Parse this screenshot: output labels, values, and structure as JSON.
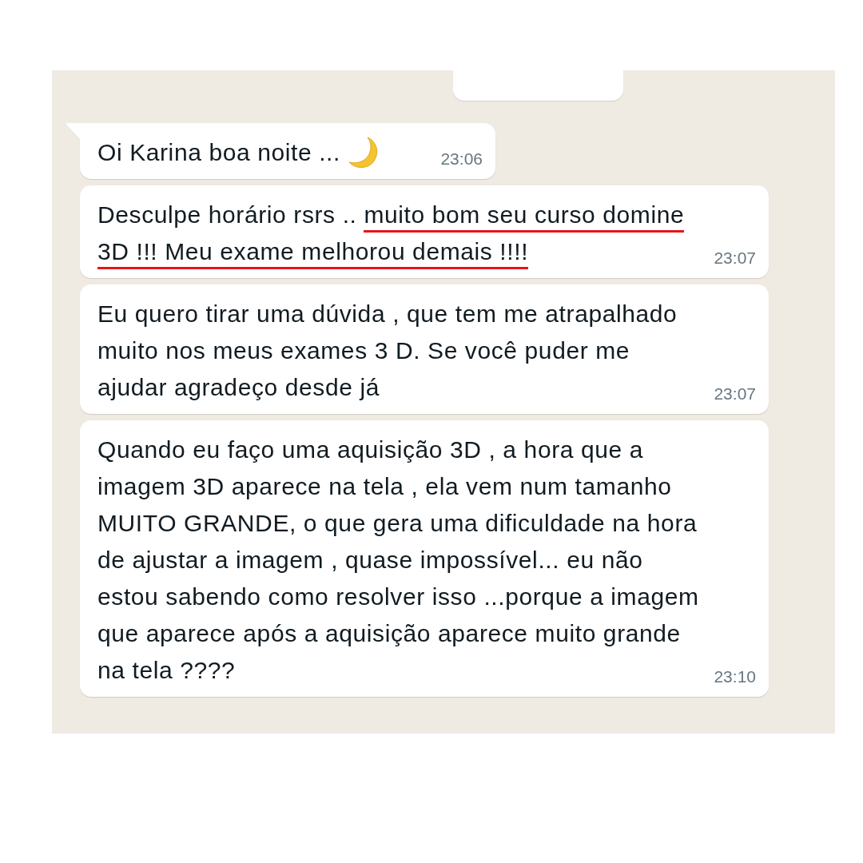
{
  "messages": [
    {
      "segments": [
        {
          "text": "Oi Karina boa noite ...",
          "underlined": false
        }
      ],
      "kind": "text-with-moon",
      "time": "23:06",
      "tail": true
    },
    {
      "segments": [
        {
          "text": "Desculpe horário rsrs .. ",
          "underlined": false
        },
        {
          "text": "muito bom seu curso domine 3D !!! Meu exame melhorou demais !!!!",
          "underlined": true
        }
      ],
      "time": "23:07",
      "tail": false,
      "kind": "text"
    },
    {
      "segments": [
        {
          "text": "Eu quero tirar uma dúvida , que tem me atrapalhado muito nos meus exames 3 D.  Se você puder me ajudar agradeço desde já",
          "underlined": false
        }
      ],
      "time": "23:07",
      "tail": false,
      "kind": "text"
    },
    {
      "segments": [
        {
          "text": "Quando eu faço uma aquisição 3D , a hora que a imagem 3D aparece na tela , ela vem num tamanho MUITO GRANDE, o que gera uma dificuldade na hora de ajustar a imagem , quase impossível... eu não estou sabendo como resolver isso ...porque a imagem que aparece após a aquisição aparece muito grande na tela ????",
          "underlined": false
        }
      ],
      "time": "23:10",
      "tail": false,
      "kind": "text"
    }
  ]
}
